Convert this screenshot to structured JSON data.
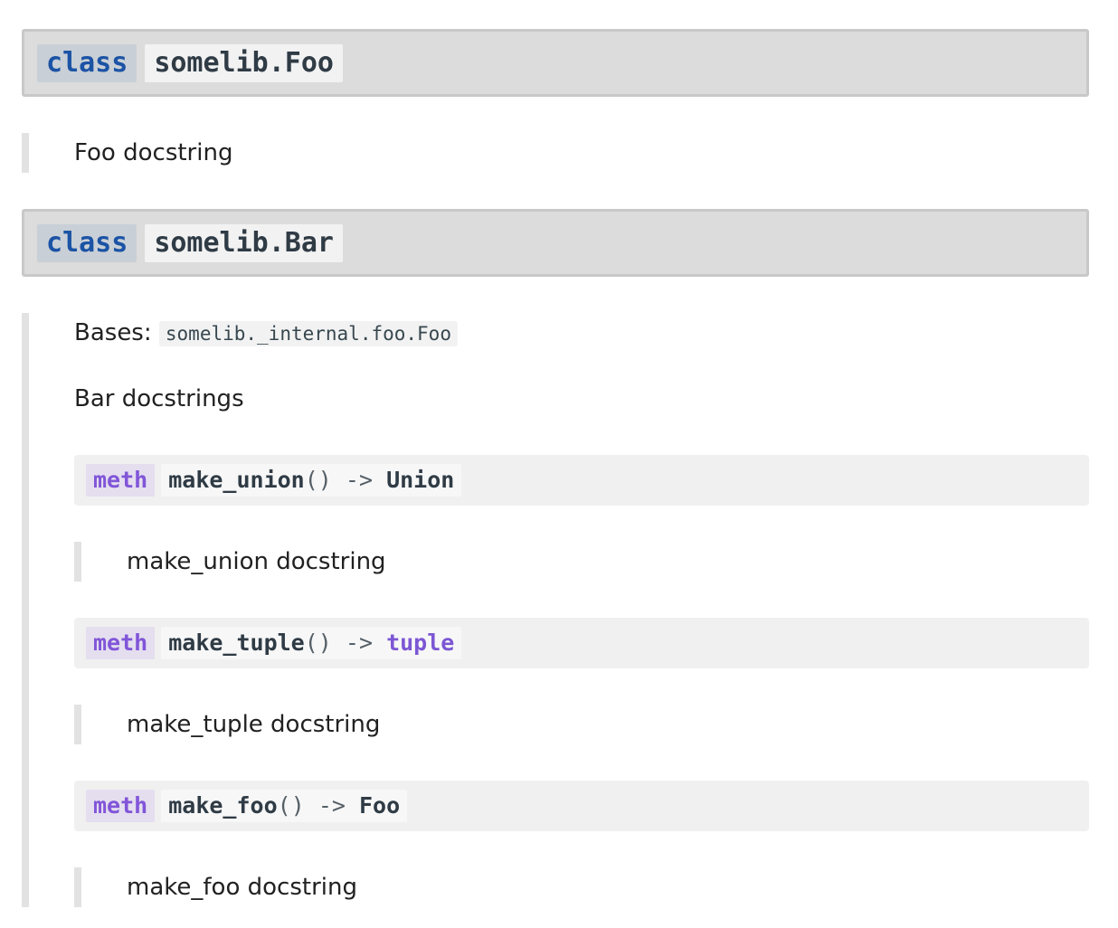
{
  "classes": [
    {
      "keyword": "class",
      "name": "somelib.Foo",
      "doc": "Foo docstring"
    },
    {
      "keyword": "class",
      "name": "somelib.Bar",
      "bases_label": "Bases:",
      "bases": "somelib._internal.foo.Foo",
      "doc": "Bar docstrings",
      "methods": [
        {
          "keyword": "meth",
          "name": "make_union",
          "parens": "()",
          "arrow": "->",
          "returns": "Union",
          "doc": "make_union docstring"
        },
        {
          "keyword": "meth",
          "name": "make_tuple",
          "parens": "()",
          "arrow": "->",
          "returns": "tuple",
          "doc": "make_tuple docstring"
        },
        {
          "keyword": "meth",
          "name": "make_foo",
          "parens": "()",
          "arrow": "->",
          "returns": "Foo",
          "doc": "make_foo docstring"
        }
      ]
    }
  ],
  "colors": {
    "class_keyword": "#1b53a5",
    "meth_keyword": "#8155d8",
    "builtin_return_type": "#7c57d4",
    "signature_bg": "#dcdcdc"
  }
}
